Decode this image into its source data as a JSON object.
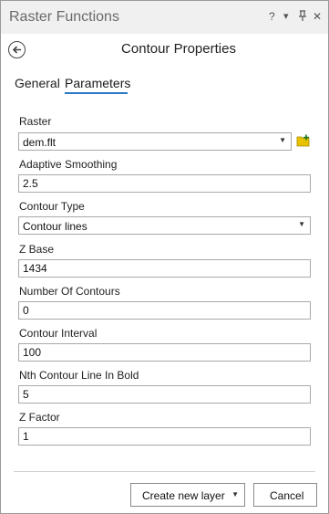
{
  "window": {
    "title": "Raster Functions",
    "controls": {
      "help": "?",
      "menu": "▾",
      "pin": "⊥",
      "close": "✕"
    }
  },
  "header": {
    "title": "Contour Properties",
    "back_icon": "back-arrow-circle-icon"
  },
  "tabs": [
    {
      "label": "General",
      "active": false
    },
    {
      "label": "Parameters",
      "active": true
    }
  ],
  "form": {
    "raster": {
      "label": "Raster",
      "value": "dem.flt",
      "browse_icon": "add-folder-icon"
    },
    "adaptive_smoothing": {
      "label": "Adaptive Smoothing",
      "value": "2.5"
    },
    "contour_type": {
      "label": "Contour Type",
      "value": "Contour lines"
    },
    "z_base": {
      "label": "Z Base",
      "value": "1434"
    },
    "number_of_contours": {
      "label": "Number Of Contours",
      "value": "0"
    },
    "contour_interval": {
      "label": "Contour Interval",
      "value": "100"
    },
    "nth_contour_bold": {
      "label": "Nth Contour Line In Bold",
      "value": "5"
    },
    "z_factor": {
      "label": "Z Factor",
      "value": "1"
    }
  },
  "footer": {
    "create_label": "Create new layer",
    "cancel_label": "Cancel"
  },
  "colors": {
    "accent": "#2b78c5",
    "folder": "#e8c200"
  }
}
